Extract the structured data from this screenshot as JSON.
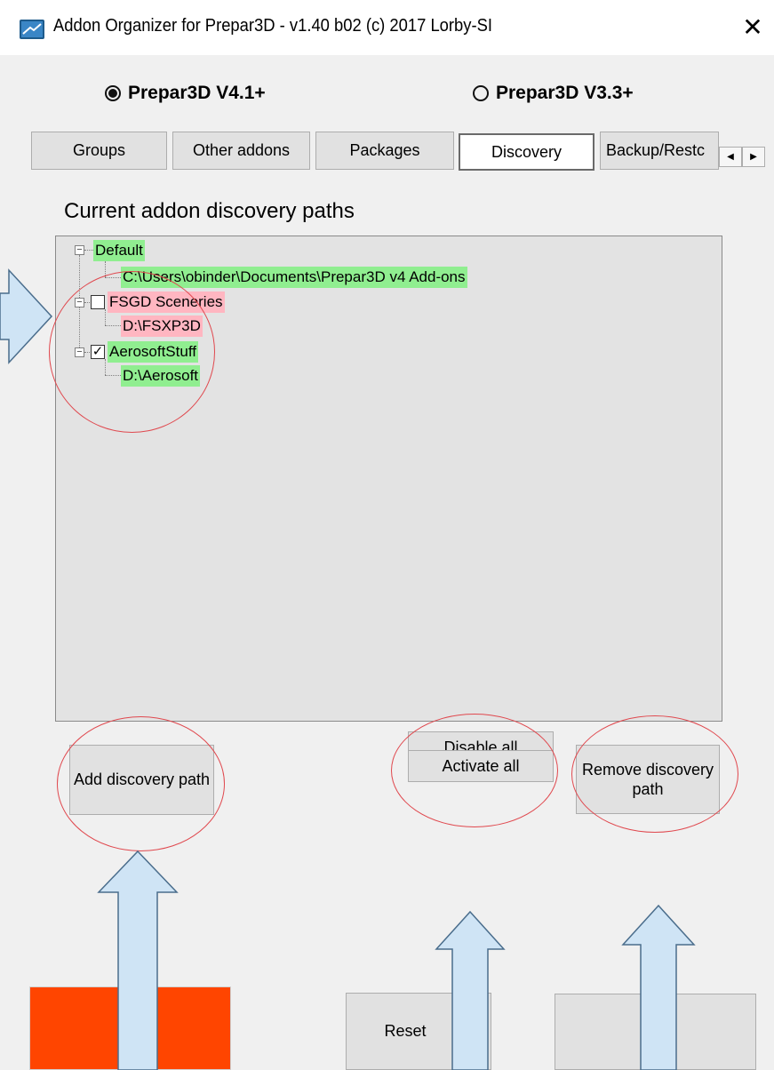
{
  "window": {
    "title": "Addon Organizer for Prepar3D - v1.40 b02 (c) 2017 Lorby-SI",
    "close_glyph": "✕",
    "icon": "app-icon"
  },
  "platform": {
    "options": [
      {
        "label": "Prepar3D V4.1+",
        "selected": true
      },
      {
        "label": "Prepar3D V3.3+",
        "selected": false
      }
    ]
  },
  "tabs": [
    {
      "label": "Groups",
      "active": false
    },
    {
      "label": "Other addons",
      "active": false
    },
    {
      "label": "Packages",
      "active": false
    },
    {
      "label": "Discovery",
      "active": true
    },
    {
      "label": "Backup/Restc",
      "active": false
    }
  ],
  "tab_scroll": {
    "left": "◀",
    "right": "▶"
  },
  "discovery": {
    "heading": "Current addon discovery paths",
    "tree": [
      {
        "label": "Default",
        "status": "active",
        "has_checkbox": false,
        "checked": null,
        "children": [
          {
            "label": "C:\\Users\\obinder\\Documents\\Prepar3D v4 Add-ons"
          }
        ]
      },
      {
        "label": "FSGD Sceneries",
        "status": "disabled",
        "has_checkbox": true,
        "checked": false,
        "children": [
          {
            "label": "D:\\FSXP3D"
          }
        ]
      },
      {
        "label": "AerosoftStuff",
        "status": "active",
        "has_checkbox": true,
        "checked": true,
        "children": [
          {
            "label": "D:\\Aerosoft"
          }
        ]
      }
    ],
    "expander_glyph": "−",
    "check_glyph": "✓"
  },
  "buttons": {
    "add_discovery_path": "Add discovery path",
    "disable_all": "Disable all",
    "activate_all": "Activate all",
    "remove_discovery_path": "Remove discovery path",
    "reset": "Reset"
  },
  "colors": {
    "active_highlight": "#90ee90",
    "disabled_highlight": "#ffb6c1",
    "save_button": "#ff4500",
    "annotation_ellipse": "#e0484e",
    "annotation_arrow_fill": "#cfe4f5",
    "annotation_arrow_stroke": "#4a6d8c"
  }
}
